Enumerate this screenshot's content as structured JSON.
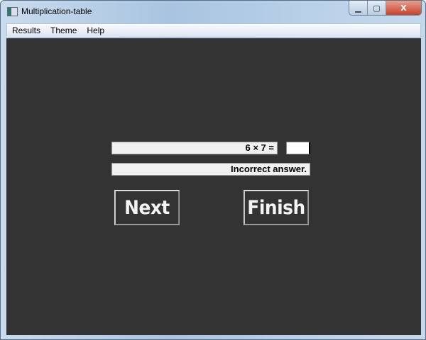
{
  "window": {
    "title": "Multiplication-table",
    "controls": {
      "minimize": "▁",
      "maximize": "▢",
      "close": "X"
    }
  },
  "menu": {
    "items": [
      "Results",
      "Theme",
      "Help"
    ]
  },
  "quiz": {
    "problem": "6 × 7 =",
    "answer": "",
    "message": "Incorrect answer."
  },
  "buttons": {
    "next": "Next",
    "finish": "Finish"
  }
}
